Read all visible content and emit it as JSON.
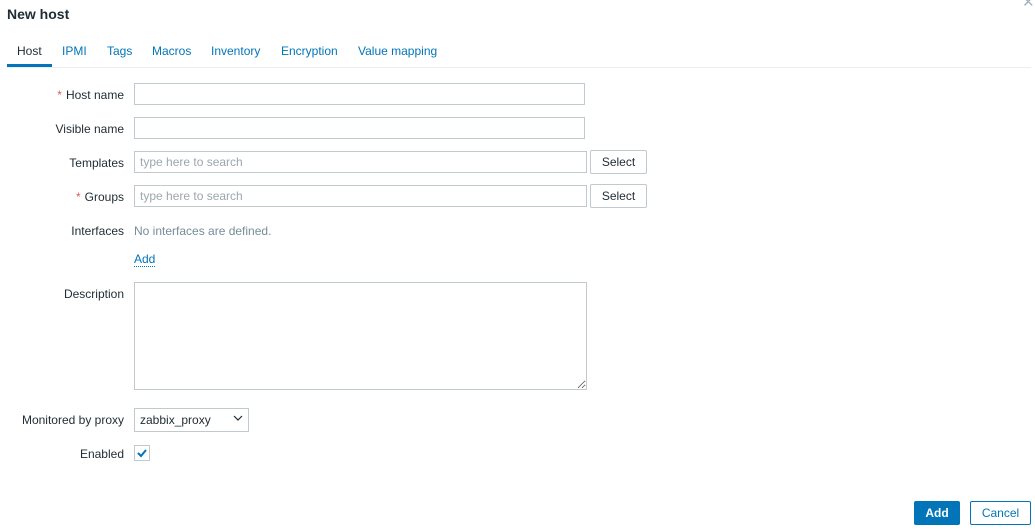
{
  "dialog": {
    "title": "New host",
    "close_icon": "close-icon"
  },
  "tabs": [
    {
      "label": "Host",
      "active": true
    },
    {
      "label": "IPMI"
    },
    {
      "label": "Tags"
    },
    {
      "label": "Macros"
    },
    {
      "label": "Inventory"
    },
    {
      "label": "Encryption"
    },
    {
      "label": "Value mapping"
    }
  ],
  "form": {
    "host_name": {
      "label": "Host name",
      "required_mark": "*",
      "value": ""
    },
    "visible_name": {
      "label": "Visible name",
      "value": ""
    },
    "templates": {
      "label": "Templates",
      "placeholder": "type here to search",
      "select_label": "Select"
    },
    "groups": {
      "label": "Groups",
      "required_mark": "*",
      "placeholder": "type here to search",
      "select_label": "Select"
    },
    "interfaces": {
      "label": "Interfaces",
      "empty_text": "No interfaces are defined.",
      "add_label": "Add"
    },
    "description": {
      "label": "Description",
      "value": ""
    },
    "proxy": {
      "label": "Monitored by proxy",
      "selected": "zabbix_proxy"
    },
    "enabled": {
      "label": "Enabled",
      "checked": true
    }
  },
  "footer": {
    "add_label": "Add",
    "cancel_label": "Cancel"
  }
}
